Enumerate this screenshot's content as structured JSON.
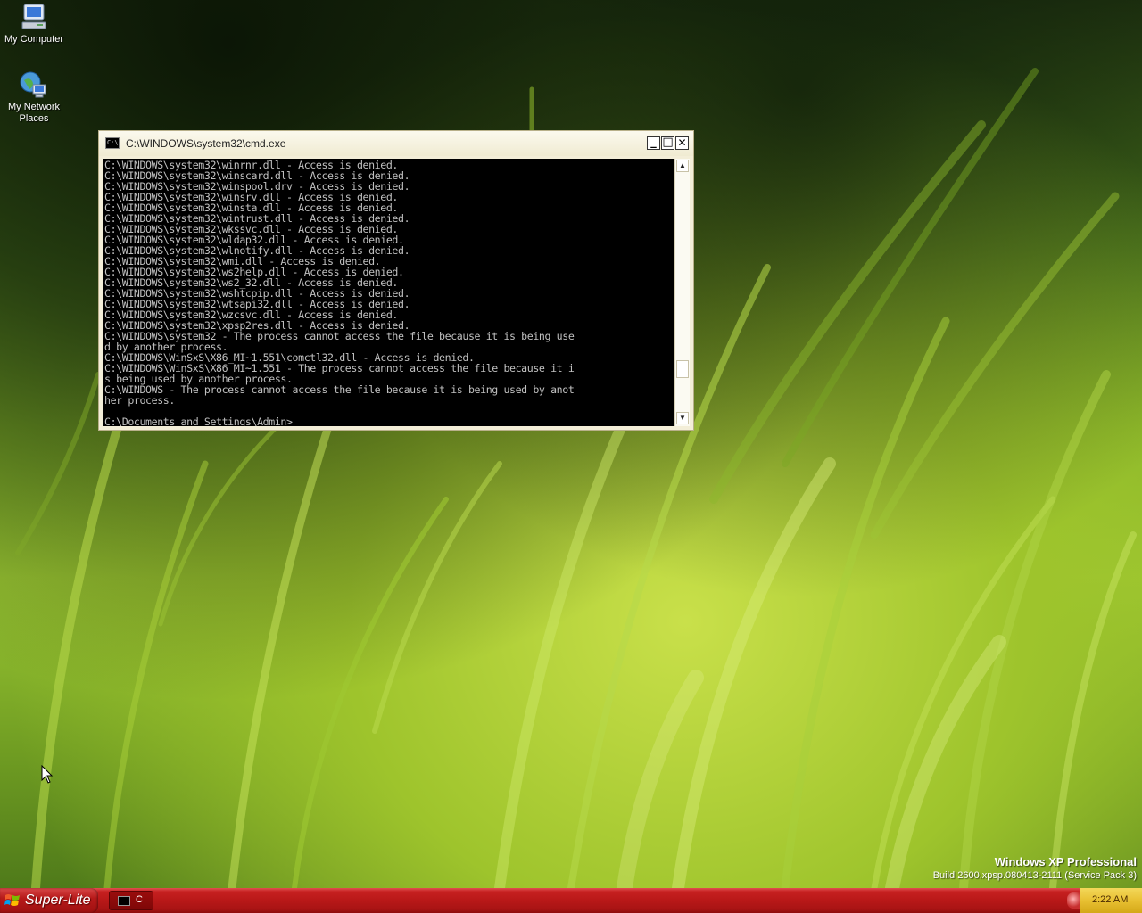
{
  "desktop": {
    "icons": [
      {
        "label": "My Computer",
        "icon": "my-computer-icon"
      },
      {
        "label": "My Network Places",
        "icon": "network-places-icon"
      }
    ],
    "watermark": {
      "edition": "Windows XP Professional",
      "build": "Build 2600.xpsp.080413-2111 (Service Pack 3)"
    }
  },
  "cmd_window": {
    "title": "C:\\WINDOWS\\system32\\cmd.exe",
    "title_icon_text": "C:\\",
    "controls": {
      "minimize": "_",
      "maximize": "□",
      "close": "✕"
    },
    "console_lines": [
      "C:\\WINDOWS\\system32\\winrnr.dll - Access is denied.",
      "C:\\WINDOWS\\system32\\winscard.dll - Access is denied.",
      "C:\\WINDOWS\\system32\\winspool.drv - Access is denied.",
      "C:\\WINDOWS\\system32\\winsrv.dll - Access is denied.",
      "C:\\WINDOWS\\system32\\winsta.dll - Access is denied.",
      "C:\\WINDOWS\\system32\\wintrust.dll - Access is denied.",
      "C:\\WINDOWS\\system32\\wkssvc.dll - Access is denied.",
      "C:\\WINDOWS\\system32\\wldap32.dll - Access is denied.",
      "C:\\WINDOWS\\system32\\wlnotify.dll - Access is denied.",
      "C:\\WINDOWS\\system32\\wmi.dll - Access is denied.",
      "C:\\WINDOWS\\system32\\ws2help.dll - Access is denied.",
      "C:\\WINDOWS\\system32\\ws2_32.dll - Access is denied.",
      "C:\\WINDOWS\\system32\\wshtcpip.dll - Access is denied.",
      "C:\\WINDOWS\\system32\\wtsapi32.dll - Access is denied.",
      "C:\\WINDOWS\\system32\\wzcsvc.dll - Access is denied.",
      "C:\\WINDOWS\\system32\\xpsp2res.dll - Access is denied.",
      "C:\\WINDOWS\\system32 - The process cannot access the file because it is being use",
      "d by another process.",
      "C:\\WINDOWS\\WinSxS\\X86_MI~1.551\\comctl32.dll - Access is denied.",
      "C:\\WINDOWS\\WinSxS\\X86_MI~1.551 - The process cannot access the file because it i",
      "s being used by another process.",
      "C:\\WINDOWS - The process cannot access the file because it is being used by anot",
      "her process.",
      "",
      "C:\\Documents and Settings\\Admin>"
    ],
    "scrollbar": {
      "up": "▲",
      "down": "▼"
    }
  },
  "taskbar": {
    "start_label": "Super-Lite",
    "tasks": [
      {
        "label": "C",
        "icon": "cmd-icon"
      }
    ],
    "clock": "2:22 AM"
  }
}
